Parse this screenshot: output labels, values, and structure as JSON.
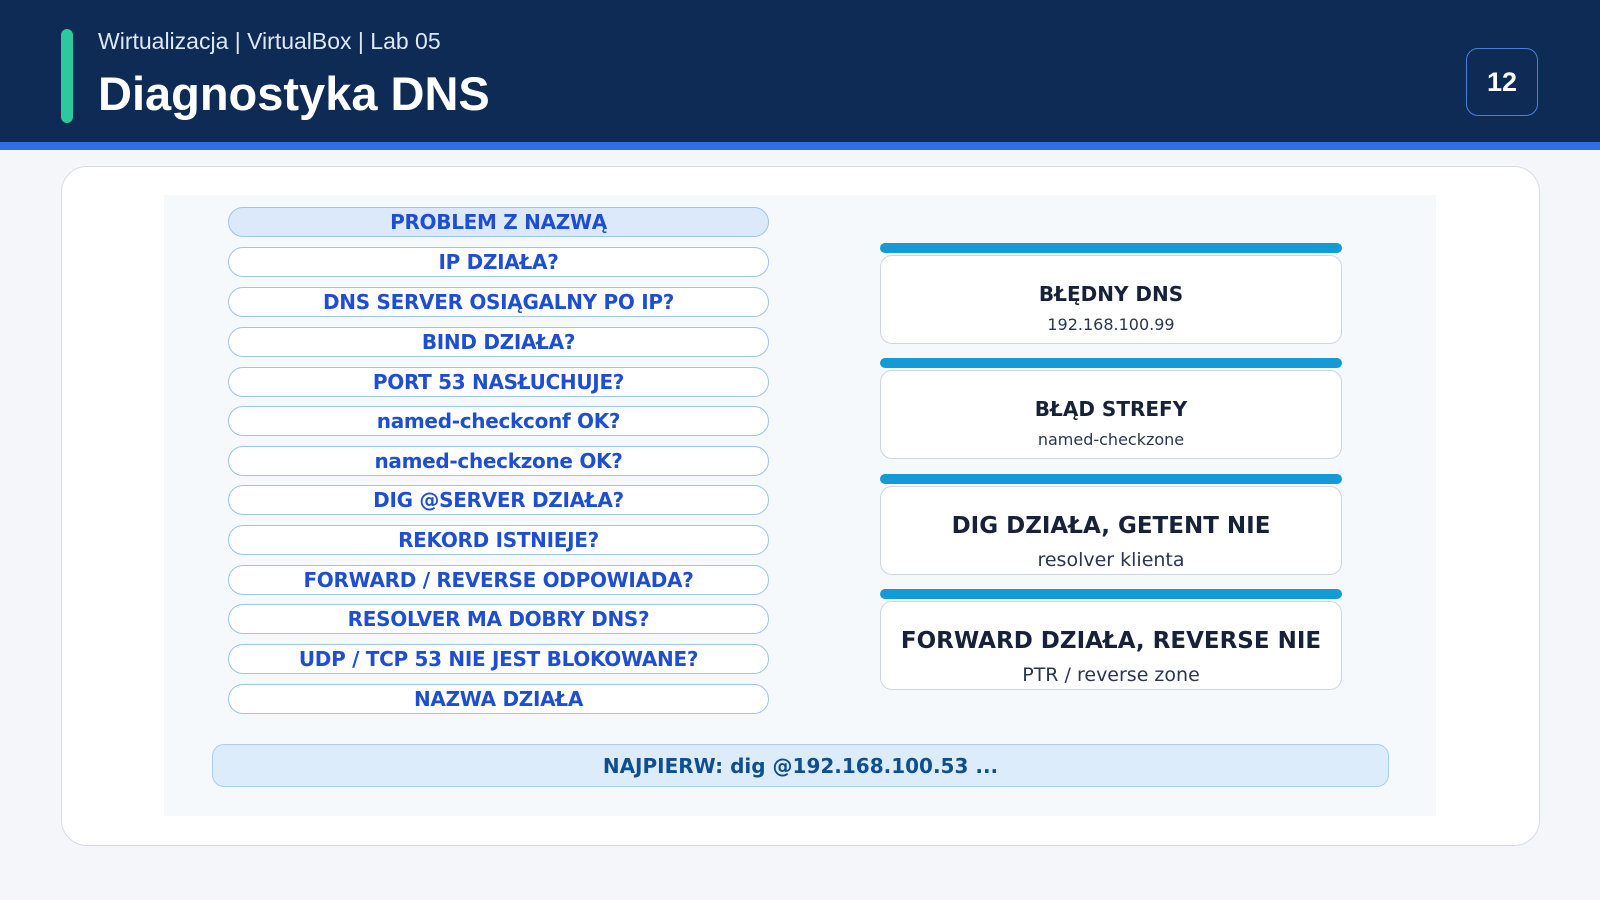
{
  "header": {
    "subtitle": "Wirtualizacja | VirtualBox | Lab 05",
    "title": "Diagnostyka DNS",
    "page_number": "12"
  },
  "flow_steps": [
    "PROBLEM Z NAZWĄ",
    "IP DZIAŁA?",
    "DNS SERVER OSIĄGALNY PO IP?",
    "BIND DZIAŁA?",
    "PORT 53 NASŁUCHUJE?",
    "named-checkconf OK?",
    "named-checkzone OK?",
    "DIG @SERVER DZIAŁA?",
    "REKORD ISTNIEJE?",
    "FORWARD / REVERSE ODPOWIADA?",
    "RESOLVER MA DOBRY DNS?",
    "UDP / TCP 53 NIE JEST BLOKOWANE?",
    "NAZWA DZIAŁA"
  ],
  "outcomes": [
    {
      "title": "BŁĘDNY DNS",
      "subtitle": "192.168.100.99"
    },
    {
      "title": "BŁĄD STREFY",
      "subtitle": "named-checkzone"
    },
    {
      "title": "DIG DZIAŁA, GETENT NIE",
      "subtitle": "resolver klienta"
    },
    {
      "title": "FORWARD DZIAŁA, REVERSE NIE",
      "subtitle": "PTR / reverse zone"
    }
  ],
  "footer_note": "NAJPIERW: dig @192.168.100.53 ...",
  "colors": {
    "header_bg": "#0d2b55",
    "accent": "#2dc8a0",
    "step_text": "#1f4fd1",
    "outcome_bar": "#159ad8"
  }
}
